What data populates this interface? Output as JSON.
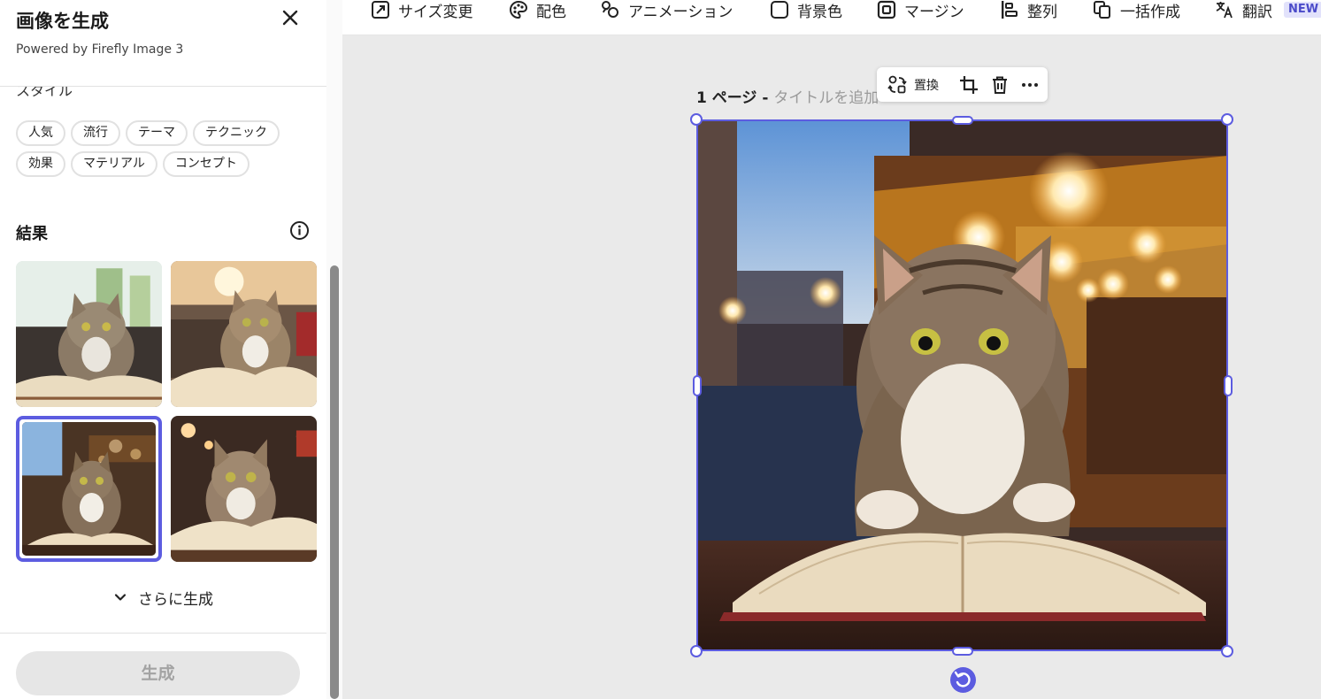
{
  "panel": {
    "title": "画像を生成",
    "subtitle": "Powered by Firefly Image 3",
    "style_label": "スタイル",
    "chips_row1": [
      "人気",
      "流行",
      "テーマ",
      "テクニック"
    ],
    "chips_row2": [
      "効果",
      "マテリアル",
      "コンセプト"
    ],
    "results_label": "結果",
    "more_label": "さらに生成",
    "generate_label": "生成",
    "selected_result": 3
  },
  "toolbar": {
    "resize": "サイズ変更",
    "color": "配色",
    "animation": "アニメーション",
    "background": "背景色",
    "margin": "マージン",
    "align": "整列",
    "bulk_create": "一括作成",
    "translate": "翻訳",
    "new_badge": "NEW"
  },
  "canvas": {
    "page_label": "1 ページ - ",
    "page_title_placeholder": "タイトルを追加",
    "replace_label": "置換"
  },
  "colors": {
    "accent": "#5c5ce0",
    "disabled_button": "#e6e6e6"
  }
}
